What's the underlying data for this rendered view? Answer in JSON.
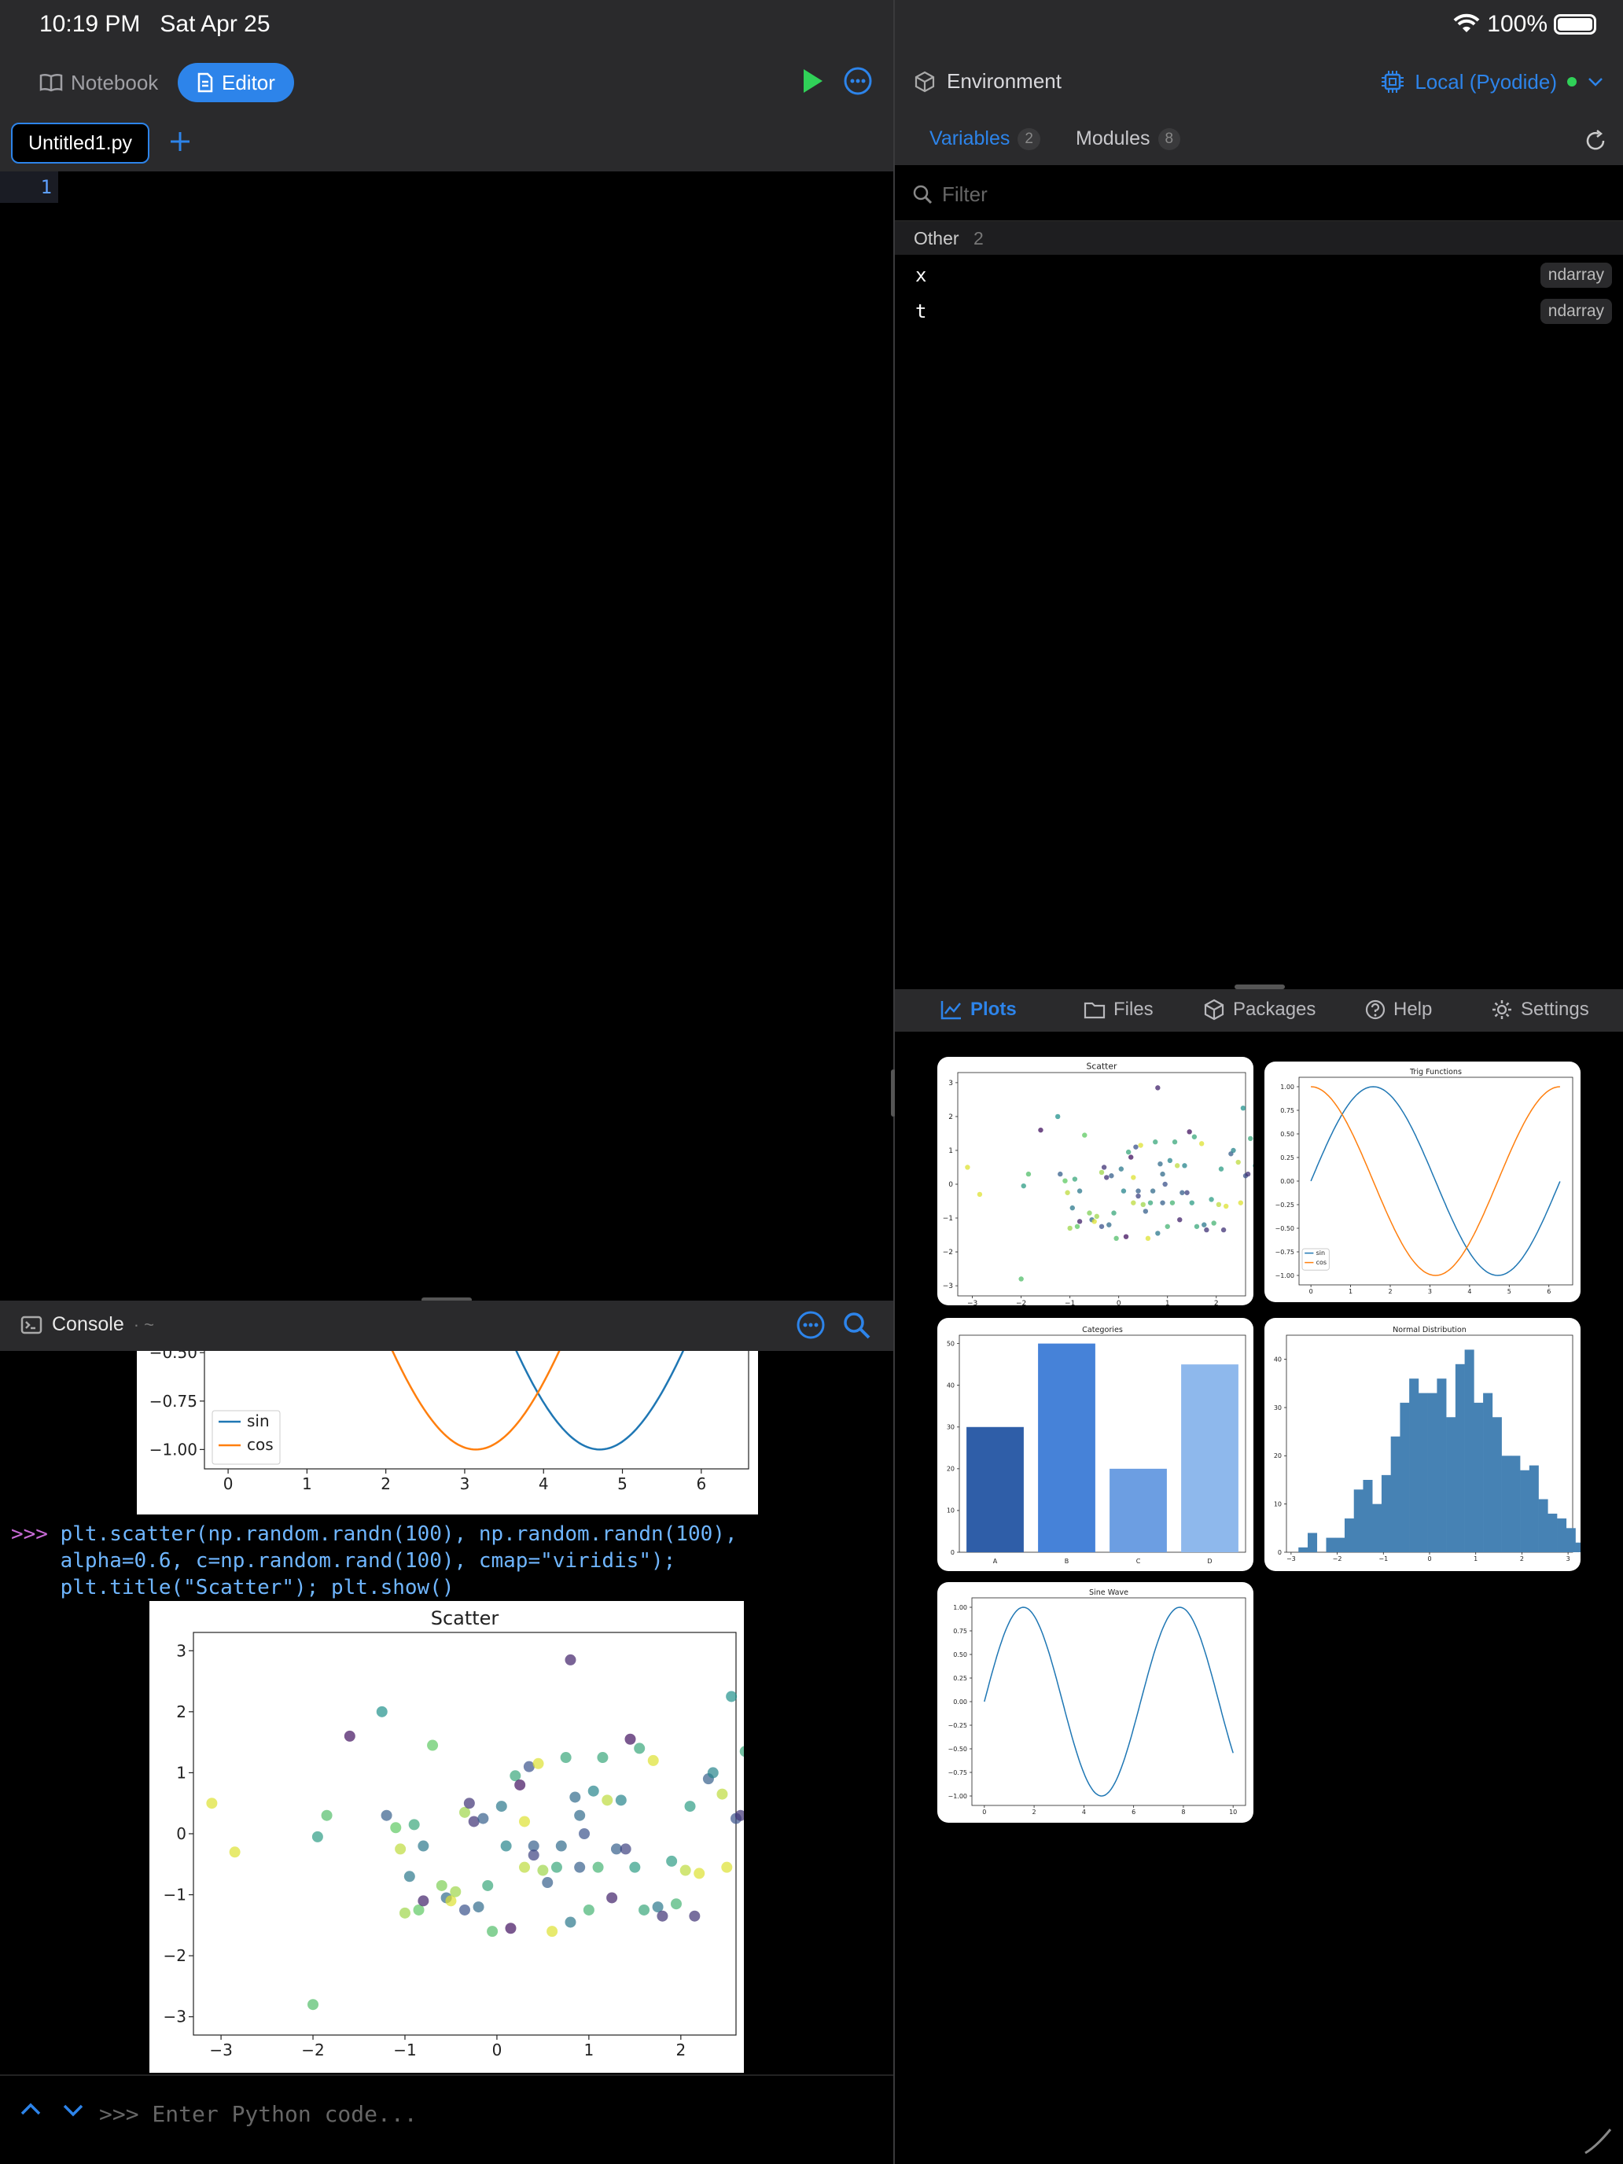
{
  "status": {
    "time": "10:19 PM   Sat Apr 25",
    "battery": "100%"
  },
  "toolbar": {
    "notebook": "Notebook",
    "editor": "Editor"
  },
  "tabs": {
    "file": "Untitled1.py"
  },
  "editor": {
    "line": "1"
  },
  "console": {
    "title": "Console",
    "path": "· ~",
    "code_prompt": ">>>",
    "code_line1": " plt.scatter(np.random.randn(100), np.random.randn(100),",
    "code_line2": "    alpha=0.6, c=np.random.rand(100), cmap=\"viridis\");",
    "code_line3": "    plt.title(\"Scatter\"); plt.show()",
    "input_placeholder": ">>> Enter Python code..."
  },
  "environment": {
    "title": "Environment",
    "kernel": "Local (Pyodide)",
    "tab_variables": "Variables",
    "variables_count": "2",
    "tab_modules": "Modules",
    "modules_count": "8",
    "filter_placeholder": "Filter",
    "group_name": "Other",
    "group_count": "2",
    "variables": [
      {
        "name": "x",
        "type": "ndarray"
      },
      {
        "name": "t",
        "type": "ndarray"
      }
    ]
  },
  "panel_tabs": {
    "plots": "Plots",
    "files": "Files",
    "packages": "Packages",
    "help": "Help",
    "settings": "Settings"
  },
  "colors": {
    "accent": "#2d84ea",
    "run": "#30d158",
    "sin": "#1f77b4",
    "cos": "#ff7f0e"
  },
  "chart_data": [
    {
      "id": "scatter",
      "type": "scatter",
      "title": "Scatter",
      "xticks": [
        -3,
        -2,
        -1,
        0,
        1,
        2
      ],
      "yticks": [
        -3,
        -2,
        -1,
        0,
        1,
        2,
        3
      ],
      "xlim": [
        -3.3,
        2.6
      ],
      "ylim": [
        -3.3,
        3.3
      ],
      "cmap": "viridis",
      "points": [
        [
          -3.1,
          0.5,
          0.95
        ],
        [
          -2.85,
          -0.3,
          0.95
        ],
        [
          -2.0,
          -2.8,
          0.7
        ],
        [
          -1.95,
          -0.05,
          0.55
        ],
        [
          -1.85,
          0.3,
          0.7
        ],
        [
          -1.6,
          1.6,
          0.05
        ],
        [
          -1.25,
          2.0,
          0.5
        ],
        [
          -1.2,
          0.3,
          0.3
        ],
        [
          -1.1,
          0.1,
          0.75
        ],
        [
          -1.05,
          -0.25,
          0.9
        ],
        [
          -1.0,
          -1.3,
          0.85
        ],
        [
          -0.95,
          -0.7,
          0.4
        ],
        [
          -0.9,
          0.15,
          0.6
        ],
        [
          -0.85,
          -1.25,
          0.75
        ],
        [
          -0.8,
          -0.2,
          0.4
        ],
        [
          -0.8,
          -1.1,
          0.1
        ],
        [
          -0.7,
          1.45,
          0.75
        ],
        [
          -0.6,
          -0.85,
          0.8
        ],
        [
          -0.55,
          -1.05,
          0.35
        ],
        [
          -0.5,
          -1.1,
          0.95
        ],
        [
          -0.45,
          -0.95,
          0.85
        ],
        [
          -0.35,
          0.35,
          0.85
        ],
        [
          -0.35,
          -1.25,
          0.25
        ],
        [
          -0.3,
          0.5,
          0.15
        ],
        [
          -0.25,
          0.2,
          0.15
        ],
        [
          -0.2,
          -1.2,
          0.35
        ],
        [
          -0.15,
          0.25,
          0.3
        ],
        [
          -0.1,
          -0.85,
          0.6
        ],
        [
          -0.05,
          -1.6,
          0.7
        ],
        [
          0.05,
          0.45,
          0.4
        ],
        [
          0.1,
          -0.2,
          0.45
        ],
        [
          0.15,
          -1.55,
          0.05
        ],
        [
          0.2,
          0.95,
          0.6
        ],
        [
          0.25,
          0.8,
          0.05
        ],
        [
          0.3,
          0.2,
          0.95
        ],
        [
          0.3,
          -0.55,
          0.9
        ],
        [
          0.35,
          1.1,
          0.25
        ],
        [
          0.4,
          -0.2,
          0.3
        ],
        [
          0.4,
          -0.35,
          0.2
        ],
        [
          0.45,
          1.15,
          0.95
        ],
        [
          0.5,
          -0.6,
          0.85
        ],
        [
          0.55,
          -0.8,
          0.3
        ],
        [
          0.6,
          -1.6,
          0.95
        ],
        [
          0.65,
          -0.55,
          0.6
        ],
        [
          0.7,
          -0.2,
          0.35
        ],
        [
          0.75,
          1.25,
          0.6
        ],
        [
          0.8,
          2.85,
          0.1
        ],
        [
          0.8,
          -1.45,
          0.4
        ],
        [
          0.85,
          0.6,
          0.35
        ],
        [
          0.9,
          -0.55,
          0.3
        ],
        [
          0.9,
          0.3,
          0.35
        ],
        [
          0.95,
          0.0,
          0.25
        ],
        [
          1.0,
          -1.25,
          0.65
        ],
        [
          1.05,
          0.7,
          0.45
        ],
        [
          1.1,
          -0.55,
          0.65
        ],
        [
          1.15,
          1.25,
          0.6
        ],
        [
          1.2,
          0.55,
          0.9
        ],
        [
          1.25,
          -1.05,
          0.1
        ],
        [
          1.3,
          -0.25,
          0.3
        ],
        [
          1.35,
          0.55,
          0.45
        ],
        [
          1.4,
          -0.25,
          0.2
        ],
        [
          1.45,
          1.55,
          0.05
        ],
        [
          1.5,
          -0.55,
          0.55
        ],
        [
          1.55,
          1.4,
          0.6
        ],
        [
          1.6,
          -1.25,
          0.6
        ],
        [
          1.7,
          1.2,
          0.95
        ],
        [
          1.75,
          -1.2,
          0.4
        ],
        [
          1.8,
          -1.35,
          0.15
        ],
        [
          1.9,
          -0.45,
          0.55
        ],
        [
          1.95,
          -1.15,
          0.65
        ],
        [
          2.05,
          -0.6,
          0.9
        ],
        [
          2.1,
          0.45,
          0.55
        ],
        [
          2.15,
          -1.35,
          0.15
        ],
        [
          2.2,
          -0.65,
          0.95
        ],
        [
          2.3,
          0.9,
          0.3
        ],
        [
          2.35,
          1.0,
          0.45
        ],
        [
          2.45,
          0.65,
          0.9
        ],
        [
          2.5,
          -0.55,
          0.95
        ],
        [
          2.55,
          2.25,
          0.5
        ],
        [
          2.6,
          0.25,
          0.25
        ],
        [
          2.65,
          0.3,
          0.15
        ],
        [
          2.7,
          1.35,
          0.6
        ],
        [
          2.8,
          0.55,
          0.5
        ],
        [
          2.9,
          0.6,
          0.15
        ],
        [
          3.0,
          -0.2,
          0.7
        ],
        [
          3.05,
          -1.5,
          0.75
        ],
        [
          3.1,
          -0.05,
          0.3
        ],
        [
          3.15,
          -0.6,
          0.55
        ],
        [
          3.2,
          -1.45,
          0.1
        ],
        [
          3.25,
          -0.9,
          0.45
        ],
        [
          3.3,
          -1.25,
          0.95
        ],
        [
          3.35,
          0.5,
          0.95
        ]
      ]
    },
    {
      "id": "trig",
      "type": "line",
      "title": "Trig Functions",
      "xticks": [
        0,
        1,
        2,
        3,
        4,
        5,
        6
      ],
      "yticks": [
        -1.0,
        -0.75,
        -0.5,
        -0.25,
        0.0,
        0.25,
        0.5,
        0.75,
        1.0
      ],
      "xlim": [
        -0.3,
        6.6
      ],
      "ylim": [
        -1.1,
        1.1
      ],
      "series": [
        {
          "name": "sin",
          "fn": "sin",
          "color": "#1f77b4"
        },
        {
          "name": "cos",
          "fn": "cos",
          "color": "#ff7f0e"
        }
      ],
      "legend": "lower-left"
    },
    {
      "id": "categories",
      "type": "bar",
      "title": "Categories",
      "categories": [
        "A",
        "B",
        "C",
        "D"
      ],
      "values": [
        30,
        50,
        20,
        45
      ],
      "yticks": [
        0,
        10,
        20,
        30,
        40,
        50
      ],
      "ylim": [
        0,
        52
      ],
      "colors": [
        "#2f5ea8",
        "#4682d8",
        "#6c9ee2",
        "#8eb8ec"
      ]
    },
    {
      "id": "normal",
      "type": "bar",
      "title": "Normal Distribution",
      "xticks": [
        -3,
        -2,
        -1,
        0,
        1,
        2,
        3
      ],
      "yticks": [
        0,
        10,
        20,
        30,
        40
      ],
      "xlim": [
        -3.1,
        3.1
      ],
      "ylim": [
        0,
        45
      ],
      "bin_start": -2.84,
      "bin_width": 0.2,
      "values": [
        1,
        4,
        0,
        3,
        3,
        7,
        13,
        15,
        10,
        16,
        24,
        31,
        36,
        33,
        33,
        36,
        28,
        39,
        42,
        31,
        33,
        28,
        20,
        20,
        17,
        18,
        11,
        8,
        7,
        5,
        2,
        3,
        1
      ]
    },
    {
      "id": "sine",
      "type": "line",
      "title": "Sine Wave",
      "xticks": [
        0,
        2,
        4,
        6,
        8,
        10
      ],
      "yticks": [
        -1.0,
        -0.75,
        -0.5,
        -0.25,
        0.0,
        0.25,
        0.5,
        0.75,
        1.0
      ],
      "xlim": [
        -0.5,
        10.5
      ],
      "ylim": [
        -1.1,
        1.1
      ],
      "series": [
        {
          "fn": "sin",
          "color": "#1f77b4"
        }
      ]
    }
  ]
}
